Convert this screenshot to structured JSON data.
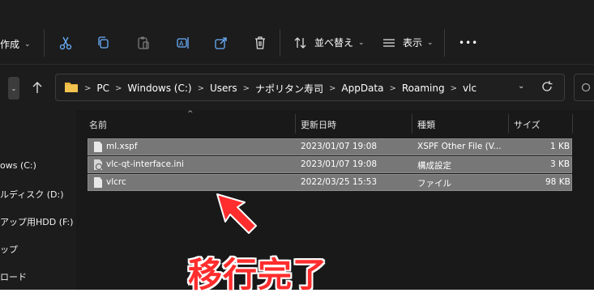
{
  "toolbar": {
    "new_label": "作成",
    "sort_label": "並べ替え",
    "view_label": "表示",
    "more_label": "•••"
  },
  "address": {
    "crumbs": [
      "PC",
      "Windows (C:)",
      "Users",
      "ナポリタン寿司",
      "AppData",
      "Roaming",
      "vlc"
    ]
  },
  "nav": {
    "items": [
      "ows (C:)",
      "ルディスク (D:)",
      "アップ用HDD (F:)",
      "ップ",
      "ロード"
    ]
  },
  "columns": {
    "name": "名前",
    "date": "更新日時",
    "type": "種類",
    "size": "サイズ"
  },
  "files": [
    {
      "name": "ml.xspf",
      "date": "2023/01/07 19:08",
      "type": "XSPF Other File (V...",
      "size": "1 KB",
      "icon": "xspf-file-icon"
    },
    {
      "name": "vlc-qt-interface.ini",
      "date": "2023/01/07 19:08",
      "type": "構成設定",
      "size": "3 KB",
      "icon": "config-file-icon"
    },
    {
      "name": "vlcrc",
      "date": "2022/03/25 15:53",
      "type": "ファイル",
      "size": "98 KB",
      "icon": "file-icon"
    }
  ],
  "annotation": {
    "text": "移行完了",
    "color": "#ff2d2d"
  },
  "colors": {
    "selection": "#777777",
    "background": "#1c1c1c"
  }
}
